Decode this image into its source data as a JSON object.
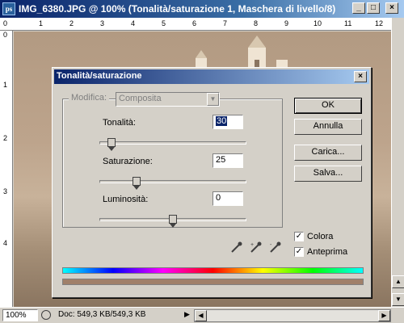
{
  "window": {
    "title": "IMG_6380.JPG @ 100% (Tonalità/saturazione 1, Maschera di livello/8)",
    "app_icon": "ps",
    "minimize": "_",
    "maximize": "□",
    "close": "×"
  },
  "rulers": {
    "top": [
      "0",
      "1",
      "2",
      "3",
      "4",
      "5",
      "6",
      "7",
      "8",
      "9",
      "10",
      "11",
      "12"
    ],
    "left": [
      "0",
      "1",
      "2",
      "3",
      "4"
    ]
  },
  "status": {
    "zoom": "100%",
    "doc_info": "Doc: 549,3 KB/549,3 KB",
    "arrow": "▶"
  },
  "dialog": {
    "title": "Tonalità/saturazione",
    "close": "×",
    "edit": {
      "label": "Modifica:",
      "value": "Composita"
    },
    "hue": {
      "label": "Tonalità:",
      "value": "30",
      "level": 0.083
    },
    "saturation": {
      "label": "Saturazione:",
      "value": "25",
      "level": 0.25
    },
    "lightness": {
      "label": "Luminosità:",
      "value": "0",
      "level": 0.5
    },
    "buttons": {
      "ok": "OK",
      "cancel": "Annulla",
      "load": "Carica...",
      "save": "Salva..."
    },
    "checkboxes": {
      "colorize": {
        "label": "Colora",
        "checked": true
      },
      "preview": {
        "label": "Anteprima",
        "checked": true
      }
    },
    "colors": {
      "result": "#a0806a"
    }
  }
}
